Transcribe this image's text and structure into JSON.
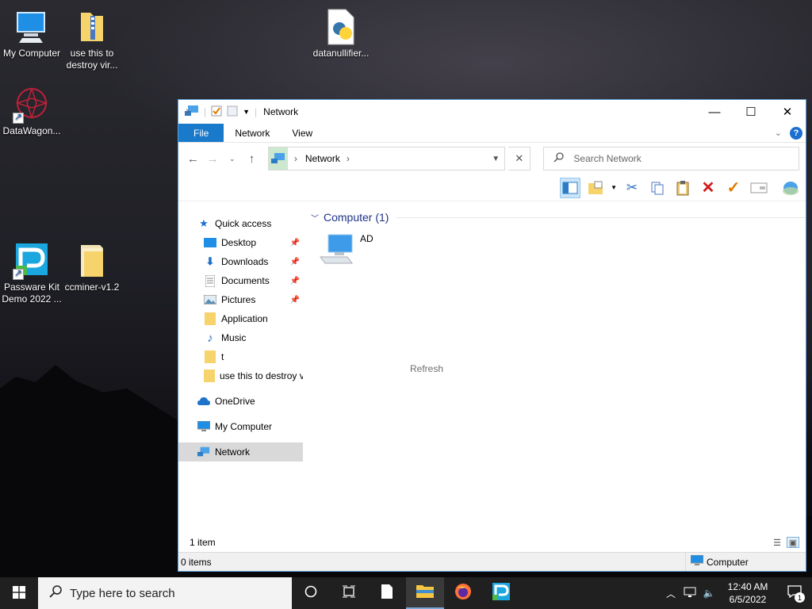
{
  "desktop": {
    "icons": [
      {
        "label": "My Computer"
      },
      {
        "label": "use this to destroy vir..."
      },
      {
        "label": "datanullifier..."
      },
      {
        "label": "DataWagon..."
      },
      {
        "label": "Passware Kit Demo 2022 ..."
      },
      {
        "label": "ccminer-v1.2"
      }
    ]
  },
  "window": {
    "title": "Network",
    "controls": {
      "minimize": "—",
      "maximize": "☐",
      "close": "✕"
    },
    "ribbon_tabs": [
      {
        "label": "File"
      },
      {
        "label": "Network"
      },
      {
        "label": "View"
      }
    ],
    "help": "?",
    "address": {
      "crumb": "Network",
      "separator": "›"
    },
    "search": {
      "placeholder": "Search Network"
    },
    "nav": {
      "quick_access": "Quick access",
      "items": [
        {
          "label": "Desktop",
          "pinned": true
        },
        {
          "label": "Downloads",
          "pinned": true
        },
        {
          "label": "Documents",
          "pinned": true
        },
        {
          "label": "Pictures",
          "pinned": true
        },
        {
          "label": "Application",
          "pinned": false
        },
        {
          "label": "Music",
          "pinned": false
        },
        {
          "label": "t",
          "pinned": false
        },
        {
          "label": "use this to destroy v",
          "pinned": false
        }
      ],
      "onedrive": "OneDrive",
      "my_computer": "My Computer",
      "network": "Network"
    },
    "content": {
      "group_header": "Computer (1)",
      "items": [
        {
          "label": "AD"
        }
      ],
      "refresh": "Refresh"
    },
    "status": {
      "count": "1 item"
    },
    "details": {
      "items": "0 items",
      "zone": "Computer"
    }
  },
  "taskbar": {
    "search_placeholder": "Type here to search",
    "time": "12:40 AM",
    "date": "6/5/2022",
    "notification_count": "1"
  },
  "colors": {
    "accent": "#1979ca",
    "taskbar": "#202020",
    "group_header": "#1e3287"
  }
}
